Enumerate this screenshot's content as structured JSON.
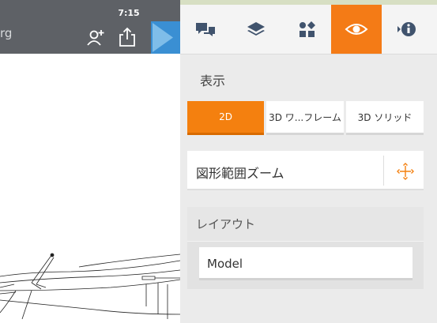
{
  "file": {
    "name_fragment": "rg"
  },
  "status": {
    "time": "7:15"
  },
  "toolbar": {
    "icons": [
      "add-user-icon",
      "share-export-icon",
      "panel-toggle-icon"
    ],
    "accent": "#3a8fd3"
  },
  "panel": {
    "tabs": [
      {
        "icon": "comments-icon",
        "active": false
      },
      {
        "icon": "layers-icon",
        "active": false
      },
      {
        "icon": "blocks-icon",
        "active": false
      },
      {
        "icon": "eye-icon",
        "active": true
      },
      {
        "icon": "info-icon",
        "active": false
      }
    ],
    "accent": "#f47b16",
    "display_heading": "表示",
    "view_modes": [
      {
        "label": "2D",
        "active": true
      },
      {
        "label": "3D ワ...フレーム",
        "active": false
      },
      {
        "label": "3D ソリッド",
        "active": false
      }
    ],
    "zoom_extents_label": "図形範囲ズーム",
    "layout_heading": "レイアウト",
    "layout_value": "Model"
  }
}
